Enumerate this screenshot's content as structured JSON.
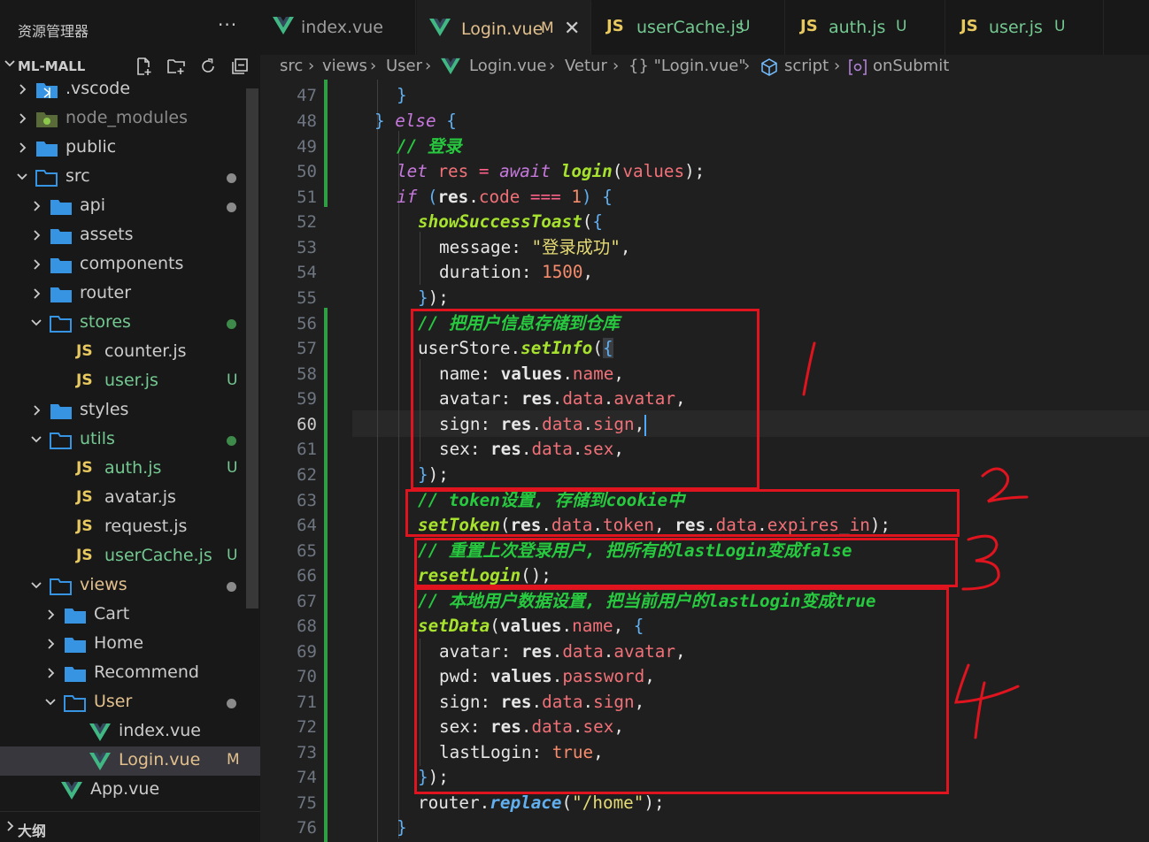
{
  "sidebar": {
    "title": "资源管理器",
    "more": "···",
    "project": "ML-MALL",
    "outline": "大纲",
    "tree": [
      {
        "label": ".vscode",
        "type": "folder-vscode",
        "depth": 1,
        "expanded": false
      },
      {
        "label": "node_modules",
        "type": "folder-node",
        "depth": 1,
        "expanded": false
      },
      {
        "label": "public",
        "type": "folder",
        "depth": 1,
        "expanded": false
      },
      {
        "label": "src",
        "type": "folder",
        "depth": 1,
        "expanded": true,
        "dot": "#8a8a8a"
      },
      {
        "label": "api",
        "type": "folder",
        "depth": 2,
        "expanded": false,
        "dot": "#8a8a8a"
      },
      {
        "label": "assets",
        "type": "folder",
        "depth": 2,
        "expanded": false
      },
      {
        "label": "components",
        "type": "folder",
        "depth": 2,
        "expanded": false
      },
      {
        "label": "router",
        "type": "folder",
        "depth": 2,
        "expanded": false
      },
      {
        "label": "stores",
        "type": "folder",
        "depth": 2,
        "expanded": true,
        "dot": "#3d8a4a",
        "color": "#73c991"
      },
      {
        "label": "counter.js",
        "type": "js",
        "depth": 3
      },
      {
        "label": "user.js",
        "type": "js",
        "depth": 3,
        "status": "U",
        "color": "#73c991"
      },
      {
        "label": "styles",
        "type": "folder",
        "depth": 2,
        "expanded": false
      },
      {
        "label": "utils",
        "type": "folder",
        "depth": 2,
        "expanded": true,
        "dot": "#3d8a4a",
        "color": "#73c991"
      },
      {
        "label": "auth.js",
        "type": "js",
        "depth": 3,
        "status": "U",
        "color": "#73c991"
      },
      {
        "label": "avatar.js",
        "type": "js",
        "depth": 3
      },
      {
        "label": "request.js",
        "type": "js",
        "depth": 3
      },
      {
        "label": "userCache.js",
        "type": "js",
        "depth": 3,
        "status": "U",
        "color": "#73c991"
      },
      {
        "label": "views",
        "type": "folder",
        "depth": 2,
        "expanded": true,
        "dot": "#8a8a8a",
        "color": "#e2c08d"
      },
      {
        "label": "Cart",
        "type": "folder",
        "depth": 3,
        "expanded": false
      },
      {
        "label": "Home",
        "type": "folder",
        "depth": 3,
        "expanded": false
      },
      {
        "label": "Recommend",
        "type": "folder",
        "depth": 3,
        "expanded": false
      },
      {
        "label": "User",
        "type": "folder",
        "depth": 3,
        "expanded": true,
        "dot": "#8a8a8a",
        "color": "#e2c08d"
      },
      {
        "label": "index.vue",
        "type": "vue",
        "depth": 4
      },
      {
        "label": "Login.vue",
        "type": "vue",
        "depth": 4,
        "status": "M",
        "color": "#e2c08d",
        "selected": true
      },
      {
        "label": "App.vue",
        "type": "vue",
        "depth": 2
      }
    ]
  },
  "tabs": [
    {
      "label": "index.vue",
      "icon": "vue-icon",
      "status": "",
      "active": false
    },
    {
      "label": "Login.vue",
      "icon": "vue-icon",
      "status": "M",
      "active": true,
      "close": "✕"
    },
    {
      "label": "userCache.js",
      "icon": "js-icon",
      "status": "U",
      "active": false
    },
    {
      "label": "auth.js",
      "icon": "js-icon",
      "status": "U",
      "active": false
    },
    {
      "label": "user.js",
      "icon": "js-icon",
      "status": "U",
      "active": false
    }
  ],
  "breadcrumb": [
    "src",
    "views",
    "User",
    "Login.vue",
    "Vetur",
    "{} \"Login.vue\"",
    "script",
    "onSubmit"
  ],
  "editor": {
    "current_line": 60,
    "line_numbers": [
      47,
      48,
      49,
      50,
      51,
      52,
      53,
      54,
      55,
      56,
      57,
      58,
      59,
      60,
      61,
      62,
      63,
      64,
      65,
      66,
      67,
      68,
      69,
      70,
      71,
      72,
      73,
      74,
      75,
      76
    ]
  },
  "annotations": [
    "1",
    "2",
    "3",
    "4"
  ],
  "colors": {
    "accent": "#4daafc",
    "annotation_red": "#e0141e",
    "modified": "#e2c08d",
    "untracked": "#73c991",
    "vue_green": "#41b883",
    "js_yellow": "#e8c95f",
    "folder_blue": "#3794e3"
  }
}
